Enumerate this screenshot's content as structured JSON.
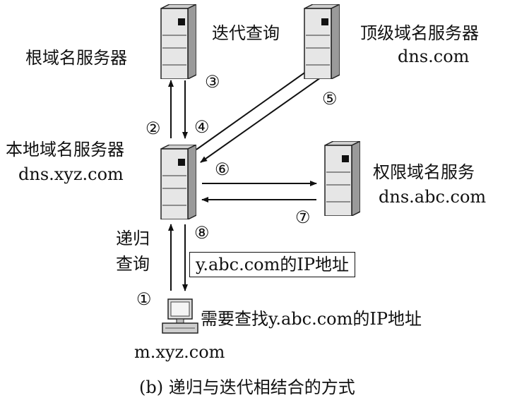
{
  "labels": {
    "iterative_query": "迭代查询",
    "root_server": "根域名服务器",
    "tld_server": "顶级域名服务器",
    "tld_domain": "dns.com",
    "local_server": "本地域名服务器",
    "local_domain": "dns.xyz.com",
    "auth_server": "权限域名服务",
    "auth_domain": "dns.abc.com",
    "recursive_line1": "递归",
    "recursive_line2": "查询",
    "reply_box": "y.abc.com的IP地址",
    "client_request": "需要查找y.abc.com的IP地址",
    "client_host": "m.xyz.com",
    "caption": "(b) 递归与迭代相结合的方式"
  },
  "steps": [
    "①",
    "②",
    "③",
    "④",
    "⑤",
    "⑥",
    "⑦",
    "⑧"
  ]
}
